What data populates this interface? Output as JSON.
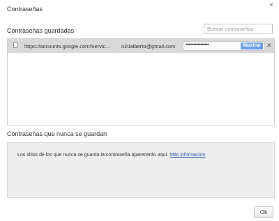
{
  "dialog": {
    "title": "Contraseñas",
    "close_glyph": "×"
  },
  "saved": {
    "title": "Contraseñas guardadas",
    "search_placeholder": "Buscar contraseñas",
    "rows": [
      {
        "icon": "page-icon",
        "url": "https://accounts.google.com/Servic...",
        "username": "n20alberto@gmail.com",
        "password_mask": "•••••••••••••••••",
        "show_label": "Mostrar",
        "remove_glyph": "✕"
      }
    ]
  },
  "never_saved": {
    "title": "Contraseñas que nunca se guardan",
    "message": "Los sitios de los que nunca se guarda la contraseña aparecerán aquí. ",
    "link_label": "Más información"
  },
  "footer": {
    "ok_label": "Ok"
  },
  "colors": {
    "selected_row": "#d9d9d9",
    "show_button": "#6d9ee9",
    "link": "#2a5db0",
    "empty_panel": "#eeeeee"
  }
}
